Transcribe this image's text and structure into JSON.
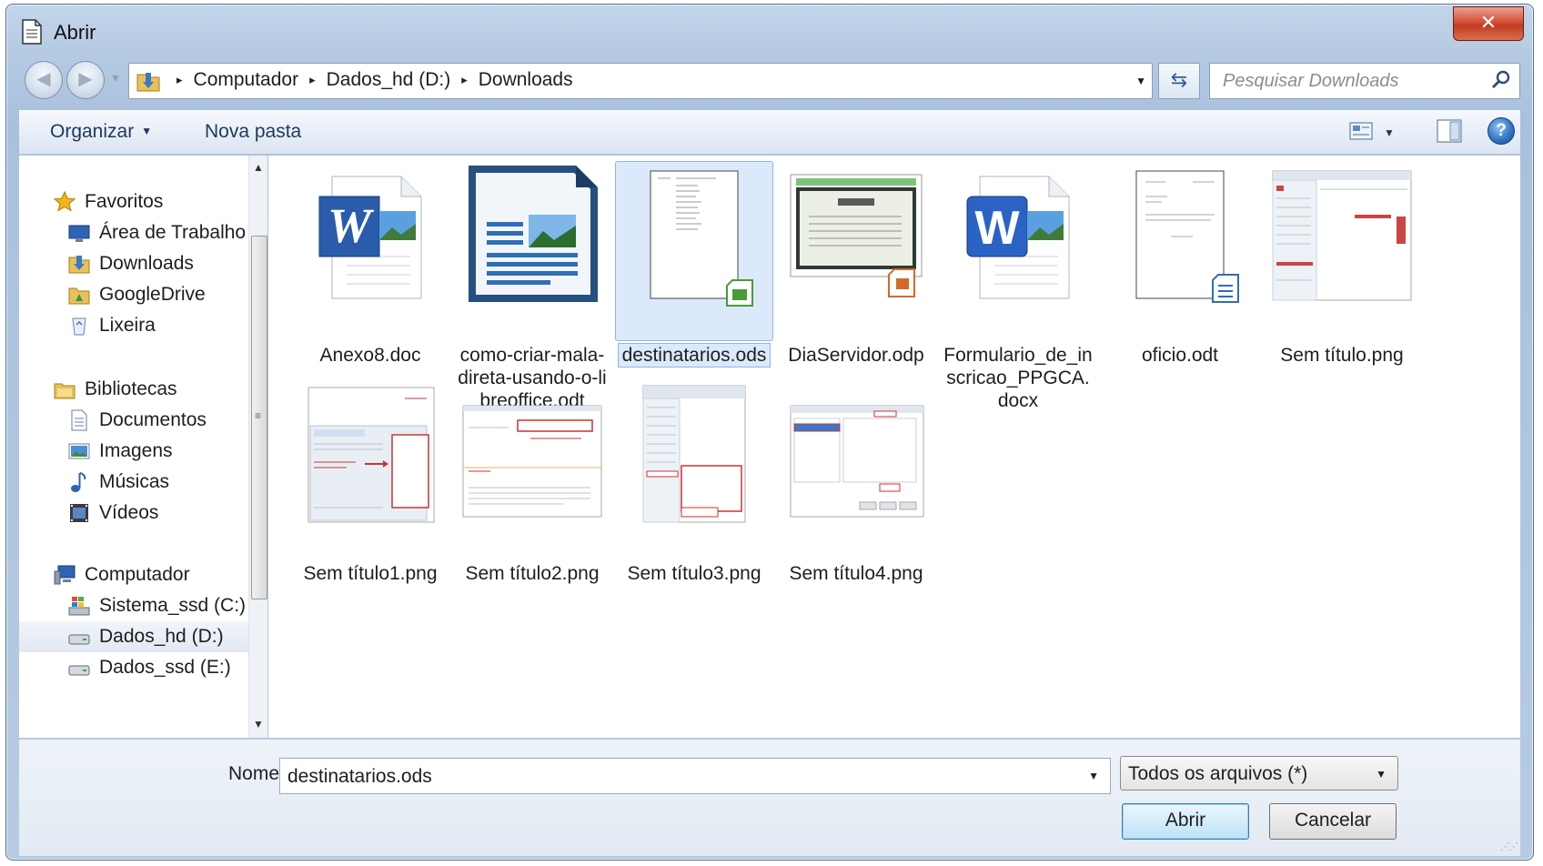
{
  "window": {
    "title": "Abrir",
    "close_glyph": "✕"
  },
  "nav": {
    "back_glyph": "◀",
    "forward_glyph": "▶",
    "breadcrumbs": [
      "Computador",
      "Dados_hd (D:)",
      "Downloads"
    ],
    "breadcrumb_separator": "▸",
    "refresh_glyph": "⇆",
    "search_placeholder": "Pesquisar Downloads"
  },
  "toolbar": {
    "organize_label": "Organizar",
    "new_folder_label": "Nova pasta",
    "help_glyph": "?"
  },
  "sidebar": {
    "items": [
      {
        "label": "Favoritos",
        "icon": "star-icon",
        "level": 0
      },
      {
        "label": "Área de Trabalho",
        "icon": "desktop-icon",
        "level": 1
      },
      {
        "label": "Downloads",
        "icon": "downloads-folder-icon",
        "level": 1
      },
      {
        "label": "GoogleDrive",
        "icon": "folder-icon",
        "level": 1
      },
      {
        "label": "Lixeira",
        "icon": "recycle-bin-icon",
        "level": 1
      },
      {
        "label": "Bibliotecas",
        "icon": "libraries-icon",
        "level": 0
      },
      {
        "label": "Documentos",
        "icon": "documents-icon",
        "level": 1
      },
      {
        "label": "Imagens",
        "icon": "pictures-icon",
        "level": 1
      },
      {
        "label": "Músicas",
        "icon": "music-icon",
        "level": 1
      },
      {
        "label": "Vídeos",
        "icon": "videos-icon",
        "level": 1
      },
      {
        "label": "Computador",
        "icon": "computer-icon",
        "level": 0
      },
      {
        "label": "Sistema_ssd (C:)",
        "icon": "system-drive-icon",
        "level": 1
      },
      {
        "label": "Dados_hd (D:)",
        "icon": "drive-icon",
        "level": 1,
        "selected": true
      },
      {
        "label": "Dados_ssd (E:)",
        "icon": "drive-icon",
        "level": 1
      }
    ]
  },
  "files": [
    {
      "name": "Anexo8.doc",
      "icon": "word-doc-icon"
    },
    {
      "name": "como-criar-mala-direta-usando-o-libreoffice.odt",
      "icon": "writer-doc-icon"
    },
    {
      "name": "destinatarios.ods",
      "icon": "calc-sheet-icon",
      "selected": true
    },
    {
      "name": "DiaServidor.odp",
      "icon": "impress-presentation-icon"
    },
    {
      "name": "Formulario_de_inscricao_PPGCA.docx",
      "icon": "word-docx-icon"
    },
    {
      "name": "oficio.odt",
      "icon": "writer-doc-thumb-icon"
    },
    {
      "name": "Sem título.png",
      "icon": "image-thumbnail-icon"
    },
    {
      "name": "Sem título1.png",
      "icon": "image-thumbnail-icon"
    },
    {
      "name": "Sem título2.png",
      "icon": "image-thumbnail-icon"
    },
    {
      "name": "Sem título3.png",
      "icon": "image-thumbnail-icon"
    },
    {
      "name": "Sem título4.png",
      "icon": "image-thumbnail-icon"
    }
  ],
  "bottom": {
    "name_label": "Nome:",
    "name_value": "destinatarios.ods",
    "filter_value": "Todos os arquivos (*)",
    "open_label": "Abrir",
    "cancel_label": "Cancelar"
  },
  "colors": {
    "selection": "#dbe9fb",
    "accent": "#2f6fc3",
    "close_red": "#c23a22"
  }
}
